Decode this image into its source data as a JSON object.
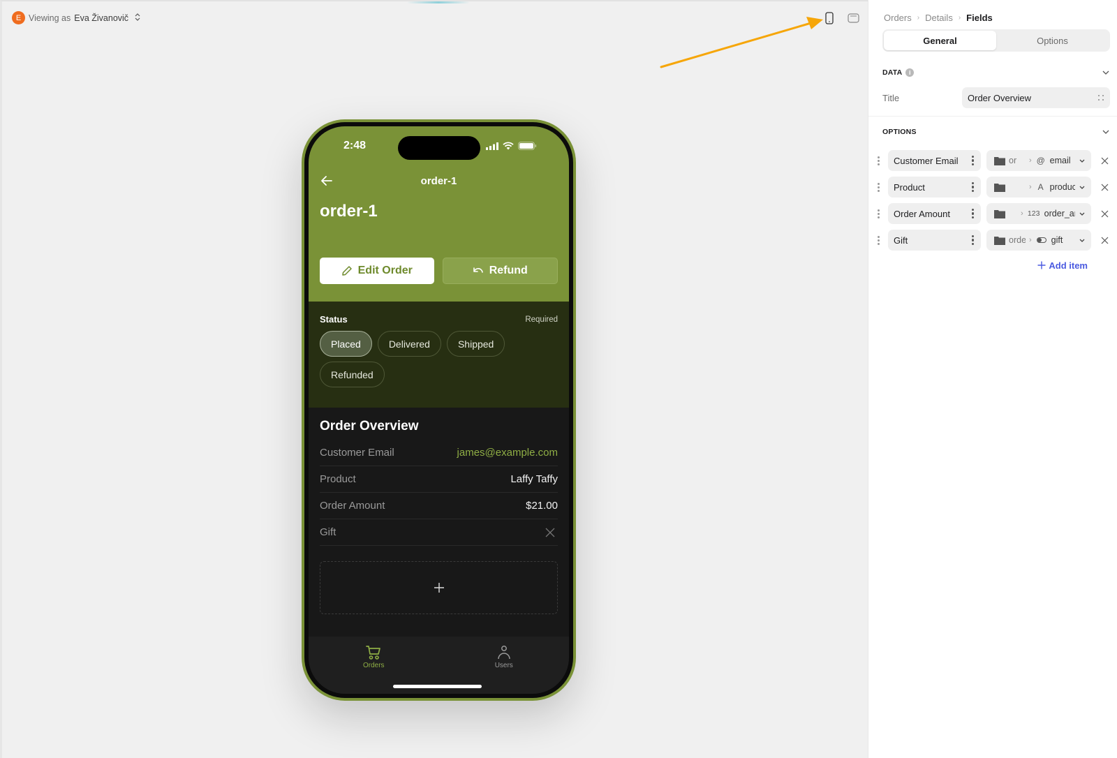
{
  "canvas": {
    "viewer": {
      "avatar_initial": "E",
      "prefix": "Viewing as",
      "name": "Eva Živanovič",
      "toggle_glyph": "⌃⌄"
    },
    "device_buttons": [
      {
        "name": "mobile",
        "icon": "phone-icon",
        "active": true
      },
      {
        "name": "tablet",
        "icon": "tablet-icon",
        "active": false
      }
    ],
    "annotation": {
      "type": "arrow",
      "color": "#f6a609",
      "points_to": "mobile-preview-button"
    }
  },
  "phone": {
    "status_bar": {
      "time": "2:48"
    },
    "navbar": {
      "title": "order-1",
      "back_icon": "arrow-left-icon"
    },
    "header_title": "order-1",
    "accent_color": "#7a9237",
    "actions": [
      {
        "label": "Edit Order",
        "icon": "pencil-icon",
        "style": "primary"
      },
      {
        "label": "Refund",
        "icon": "undo-icon",
        "style": "secondary"
      }
    ],
    "status": {
      "label": "Status",
      "required_label": "Required",
      "options": [
        "Placed",
        "Delivered",
        "Shipped",
        "Refunded"
      ],
      "selected": "Placed"
    },
    "overview": {
      "title": "Order Overview",
      "rows": [
        {
          "key": "Customer Email",
          "value": "james@example.com",
          "kind": "link"
        },
        {
          "key": "Product",
          "value": "Laffy Taffy",
          "kind": "text"
        },
        {
          "key": "Order Amount",
          "value": "$21.00",
          "kind": "text"
        },
        {
          "key": "Gift",
          "value": "",
          "kind": "boolean-false"
        }
      ],
      "add_icon": "plus-icon"
    },
    "tabs": [
      {
        "label": "Orders",
        "icon": "cart-icon",
        "active": true
      },
      {
        "label": "Users",
        "icon": "user-icon",
        "active": false
      }
    ]
  },
  "panel": {
    "breadcrumb": [
      "Orders",
      "Details",
      "Fields"
    ],
    "segments": [
      {
        "label": "General",
        "active": true
      },
      {
        "label": "Options",
        "active": false
      }
    ],
    "data_section": {
      "label": "DATA",
      "title_label": "Title",
      "title_value": "Order Overview"
    },
    "options_section": {
      "label": "OPTIONS",
      "items": [
        {
          "label": "Customer Email",
          "path": "or",
          "type_glyph": "@",
          "field": "email"
        },
        {
          "label": "Product",
          "path": "",
          "type_glyph": "A",
          "field": "product"
        },
        {
          "label": "Order Amount",
          "path": "",
          "type_glyph": "123",
          "field": "order_ar"
        },
        {
          "label": "Gift",
          "path": "orde",
          "type_glyph": "toggle",
          "field": "gift"
        }
      ],
      "add_label": "Add item"
    }
  }
}
